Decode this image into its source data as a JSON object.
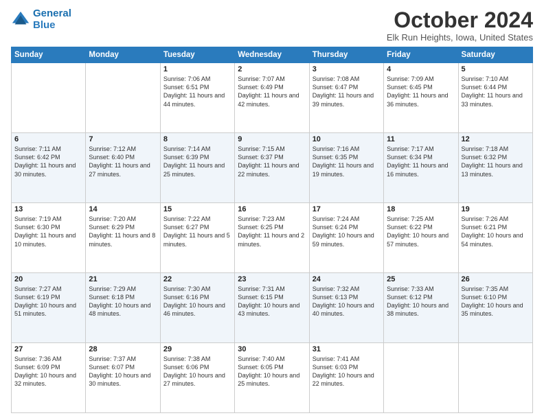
{
  "logo": {
    "line1": "General",
    "line2": "Blue"
  },
  "title": "October 2024",
  "location": "Elk Run Heights, Iowa, United States",
  "weekdays": [
    "Sunday",
    "Monday",
    "Tuesday",
    "Wednesday",
    "Thursday",
    "Friday",
    "Saturday"
  ],
  "weeks": [
    [
      {
        "day": "",
        "sunrise": "",
        "sunset": "",
        "daylight": ""
      },
      {
        "day": "",
        "sunrise": "",
        "sunset": "",
        "daylight": ""
      },
      {
        "day": "1",
        "sunrise": "Sunrise: 7:06 AM",
        "sunset": "Sunset: 6:51 PM",
        "daylight": "Daylight: 11 hours and 44 minutes."
      },
      {
        "day": "2",
        "sunrise": "Sunrise: 7:07 AM",
        "sunset": "Sunset: 6:49 PM",
        "daylight": "Daylight: 11 hours and 42 minutes."
      },
      {
        "day": "3",
        "sunrise": "Sunrise: 7:08 AM",
        "sunset": "Sunset: 6:47 PM",
        "daylight": "Daylight: 11 hours and 39 minutes."
      },
      {
        "day": "4",
        "sunrise": "Sunrise: 7:09 AM",
        "sunset": "Sunset: 6:45 PM",
        "daylight": "Daylight: 11 hours and 36 minutes."
      },
      {
        "day": "5",
        "sunrise": "Sunrise: 7:10 AM",
        "sunset": "Sunset: 6:44 PM",
        "daylight": "Daylight: 11 hours and 33 minutes."
      }
    ],
    [
      {
        "day": "6",
        "sunrise": "Sunrise: 7:11 AM",
        "sunset": "Sunset: 6:42 PM",
        "daylight": "Daylight: 11 hours and 30 minutes."
      },
      {
        "day": "7",
        "sunrise": "Sunrise: 7:12 AM",
        "sunset": "Sunset: 6:40 PM",
        "daylight": "Daylight: 11 hours and 27 minutes."
      },
      {
        "day": "8",
        "sunrise": "Sunrise: 7:14 AM",
        "sunset": "Sunset: 6:39 PM",
        "daylight": "Daylight: 11 hours and 25 minutes."
      },
      {
        "day": "9",
        "sunrise": "Sunrise: 7:15 AM",
        "sunset": "Sunset: 6:37 PM",
        "daylight": "Daylight: 11 hours and 22 minutes."
      },
      {
        "day": "10",
        "sunrise": "Sunrise: 7:16 AM",
        "sunset": "Sunset: 6:35 PM",
        "daylight": "Daylight: 11 hours and 19 minutes."
      },
      {
        "day": "11",
        "sunrise": "Sunrise: 7:17 AM",
        "sunset": "Sunset: 6:34 PM",
        "daylight": "Daylight: 11 hours and 16 minutes."
      },
      {
        "day": "12",
        "sunrise": "Sunrise: 7:18 AM",
        "sunset": "Sunset: 6:32 PM",
        "daylight": "Daylight: 11 hours and 13 minutes."
      }
    ],
    [
      {
        "day": "13",
        "sunrise": "Sunrise: 7:19 AM",
        "sunset": "Sunset: 6:30 PM",
        "daylight": "Daylight: 11 hours and 10 minutes."
      },
      {
        "day": "14",
        "sunrise": "Sunrise: 7:20 AM",
        "sunset": "Sunset: 6:29 PM",
        "daylight": "Daylight: 11 hours and 8 minutes."
      },
      {
        "day": "15",
        "sunrise": "Sunrise: 7:22 AM",
        "sunset": "Sunset: 6:27 PM",
        "daylight": "Daylight: 11 hours and 5 minutes."
      },
      {
        "day": "16",
        "sunrise": "Sunrise: 7:23 AM",
        "sunset": "Sunset: 6:25 PM",
        "daylight": "Daylight: 11 hours and 2 minutes."
      },
      {
        "day": "17",
        "sunrise": "Sunrise: 7:24 AM",
        "sunset": "Sunset: 6:24 PM",
        "daylight": "Daylight: 10 hours and 59 minutes."
      },
      {
        "day": "18",
        "sunrise": "Sunrise: 7:25 AM",
        "sunset": "Sunset: 6:22 PM",
        "daylight": "Daylight: 10 hours and 57 minutes."
      },
      {
        "day": "19",
        "sunrise": "Sunrise: 7:26 AM",
        "sunset": "Sunset: 6:21 PM",
        "daylight": "Daylight: 10 hours and 54 minutes."
      }
    ],
    [
      {
        "day": "20",
        "sunrise": "Sunrise: 7:27 AM",
        "sunset": "Sunset: 6:19 PM",
        "daylight": "Daylight: 10 hours and 51 minutes."
      },
      {
        "day": "21",
        "sunrise": "Sunrise: 7:29 AM",
        "sunset": "Sunset: 6:18 PM",
        "daylight": "Daylight: 10 hours and 48 minutes."
      },
      {
        "day": "22",
        "sunrise": "Sunrise: 7:30 AM",
        "sunset": "Sunset: 6:16 PM",
        "daylight": "Daylight: 10 hours and 46 minutes."
      },
      {
        "day": "23",
        "sunrise": "Sunrise: 7:31 AM",
        "sunset": "Sunset: 6:15 PM",
        "daylight": "Daylight: 10 hours and 43 minutes."
      },
      {
        "day": "24",
        "sunrise": "Sunrise: 7:32 AM",
        "sunset": "Sunset: 6:13 PM",
        "daylight": "Daylight: 10 hours and 40 minutes."
      },
      {
        "day": "25",
        "sunrise": "Sunrise: 7:33 AM",
        "sunset": "Sunset: 6:12 PM",
        "daylight": "Daylight: 10 hours and 38 minutes."
      },
      {
        "day": "26",
        "sunrise": "Sunrise: 7:35 AM",
        "sunset": "Sunset: 6:10 PM",
        "daylight": "Daylight: 10 hours and 35 minutes."
      }
    ],
    [
      {
        "day": "27",
        "sunrise": "Sunrise: 7:36 AM",
        "sunset": "Sunset: 6:09 PM",
        "daylight": "Daylight: 10 hours and 32 minutes."
      },
      {
        "day": "28",
        "sunrise": "Sunrise: 7:37 AM",
        "sunset": "Sunset: 6:07 PM",
        "daylight": "Daylight: 10 hours and 30 minutes."
      },
      {
        "day": "29",
        "sunrise": "Sunrise: 7:38 AM",
        "sunset": "Sunset: 6:06 PM",
        "daylight": "Daylight: 10 hours and 27 minutes."
      },
      {
        "day": "30",
        "sunrise": "Sunrise: 7:40 AM",
        "sunset": "Sunset: 6:05 PM",
        "daylight": "Daylight: 10 hours and 25 minutes."
      },
      {
        "day": "31",
        "sunrise": "Sunrise: 7:41 AM",
        "sunset": "Sunset: 6:03 PM",
        "daylight": "Daylight: 10 hours and 22 minutes."
      },
      {
        "day": "",
        "sunrise": "",
        "sunset": "",
        "daylight": ""
      },
      {
        "day": "",
        "sunrise": "",
        "sunset": "",
        "daylight": ""
      }
    ]
  ]
}
